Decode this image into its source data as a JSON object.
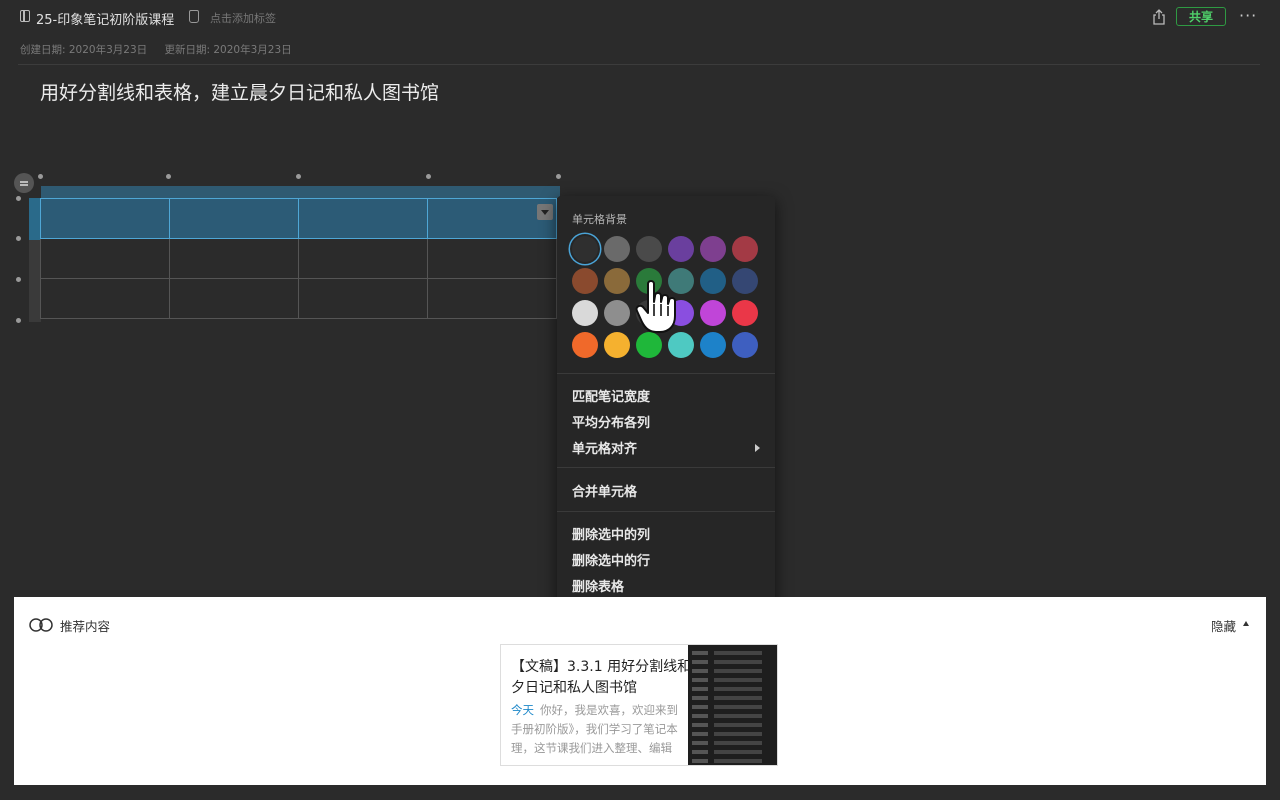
{
  "topbar": {
    "notebook_title": "25-印象笔记初阶版课程",
    "tag_placeholder": "点击添加标签",
    "share_label": "共享",
    "more_label": "···"
  },
  "dates": {
    "created": "创建日期: 2020年3月23日",
    "updated": "更新日期: 2020年3月23日"
  },
  "note": {
    "heading": "用好分割线和表格，建立晨夕日记和私人图书馆"
  },
  "table": {
    "rows": 3,
    "cols": 4,
    "selected_row": 1
  },
  "context_menu": {
    "heading": "单元格背景",
    "swatch_colors": [
      "#2f2f2f",
      "#6a6a6a",
      "#4a4a4a",
      "#6a3f9e",
      "#7e3f8f",
      "#a33a45",
      "#8a4a2e",
      "#8a6a3a",
      "#2a7a3a",
      "#3f7a78",
      "#215f86",
      "#354773",
      "#d9d9d9",
      "#8e8e8e",
      "#3a3a3a",
      "#8a4ee0",
      "#c045d8",
      "#ea3748",
      "#f0692a",
      "#f5b12f",
      "#1fb73a",
      "#4ec9c2",
      "#1d82c9",
      "#3e5fc0"
    ],
    "selected_swatch": 0,
    "items": {
      "match_width": "匹配笔记宽度",
      "distribute_cols": "平均分布各列",
      "cell_align": "单元格对齐",
      "merge_cells": "合并单元格",
      "delete_cols": "删除选中的列",
      "delete_rows": "删除选中的行",
      "delete_table": "删除表格"
    }
  },
  "recommend": {
    "title": "推荐内容",
    "hide_label": "隐藏",
    "card": {
      "title_line1": "【文稿】3.3.1 用好分割线和",
      "title_line2": "夕日记和私人图书馆",
      "date": "今天",
      "snippet_line1": "你好，我是欢喜，欢迎来到",
      "snippet_line2": "手册初阶版》，我们学习了笔记本",
      "snippet_line3": "理，这节课我们进入整理、编辑"
    }
  },
  "icons": {
    "note": "notebook-icon",
    "tag": "tag-icon",
    "share": "share-icon",
    "more": "more-icon",
    "recommend": "recommend-icon",
    "cursor": "hand-cursor-icon"
  },
  "colors": {
    "accent_green": "#4fd06a",
    "selection_blue": "#4fa7d6",
    "link_blue": "#1e88c9"
  }
}
